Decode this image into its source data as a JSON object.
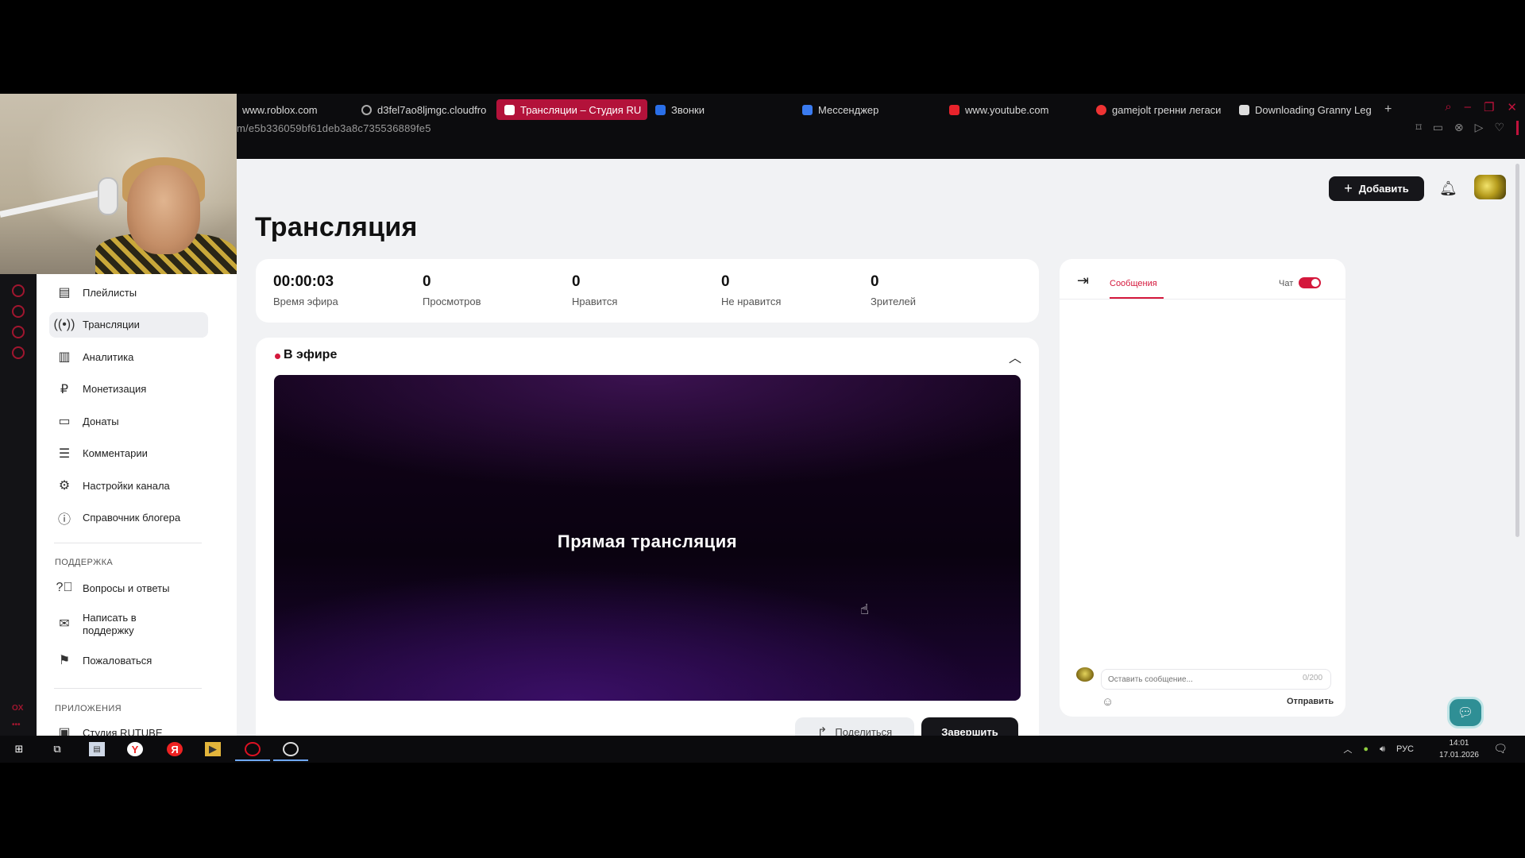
{
  "browser": {
    "tabs": [
      {
        "label": "www.roblox.com",
        "active": false
      },
      {
        "label": "d3fel7ao8ljmgc.cloudfro",
        "active": false
      },
      {
        "label": "Трансляции – Студия RU",
        "active": true
      },
      {
        "label": "Звонки",
        "active": false
      },
      {
        "label": "Мессенджер",
        "active": false
      },
      {
        "label": "www.youtube.com",
        "active": false
      },
      {
        "label": "gamejolt гренни легаси",
        "active": false
      },
      {
        "label": "Downloading Granny Leg",
        "active": false
      }
    ],
    "url": "m/e5b336059bf61deb3a8c735536889fe5",
    "accent": "#b3123a"
  },
  "header": {
    "add_label": "Добавить"
  },
  "page": {
    "title": "Трансляция"
  },
  "stats": [
    {
      "value": "00:00:03",
      "label": "Время эфира"
    },
    {
      "value": "0",
      "label": "Просмотров"
    },
    {
      "value": "0",
      "label": "Нравится"
    },
    {
      "value": "0",
      "label": "Не нравится"
    },
    {
      "value": "0",
      "label": "Зрителей"
    }
  ],
  "live": {
    "status": "В эфире",
    "player_text": "Прямая трансляция",
    "share_label": "Поделиться",
    "end_label": "Завершить"
  },
  "chat": {
    "tab_label": "Сообщения",
    "toggle_label": "Чат",
    "toggle_on": true,
    "input_placeholder": "Оставить сообщение...",
    "counter": "0/200",
    "send_label": "Отправить"
  },
  "sidebar": {
    "items": [
      {
        "label": "Плейлисты",
        "icon": "playlist-icon",
        "active": false
      },
      {
        "label": "Трансляции",
        "icon": "broadcast-icon",
        "active": true
      },
      {
        "label": "Аналитика",
        "icon": "analytics-icon",
        "active": false
      },
      {
        "label": "Монетизация",
        "icon": "ruble-icon",
        "active": false
      },
      {
        "label": "Донаты",
        "icon": "wallet-icon",
        "active": false
      },
      {
        "label": "Комментарии",
        "icon": "comment-icon",
        "active": false
      },
      {
        "label": "Настройки канала",
        "icon": "gear-icon",
        "active": false
      },
      {
        "label": "Справочник блогера",
        "icon": "info-icon",
        "active": false
      }
    ],
    "support_heading": "ПОДДЕРЖКА",
    "support_items": [
      {
        "label": "Вопросы и ответы",
        "icon": "question-icon"
      },
      {
        "label": "Написать в поддержку",
        "icon": "mail-icon"
      },
      {
        "label": "Пожаловаться",
        "icon": "flag-icon"
      }
    ],
    "apps_heading": "ПРИЛОЖЕНИЯ",
    "apps_items": [
      {
        "label": "Студия RUTUBE",
        "icon": "app-icon"
      }
    ]
  },
  "taskbar": {
    "language": "РУС",
    "time": "14:01",
    "date": "17.01.2026"
  }
}
